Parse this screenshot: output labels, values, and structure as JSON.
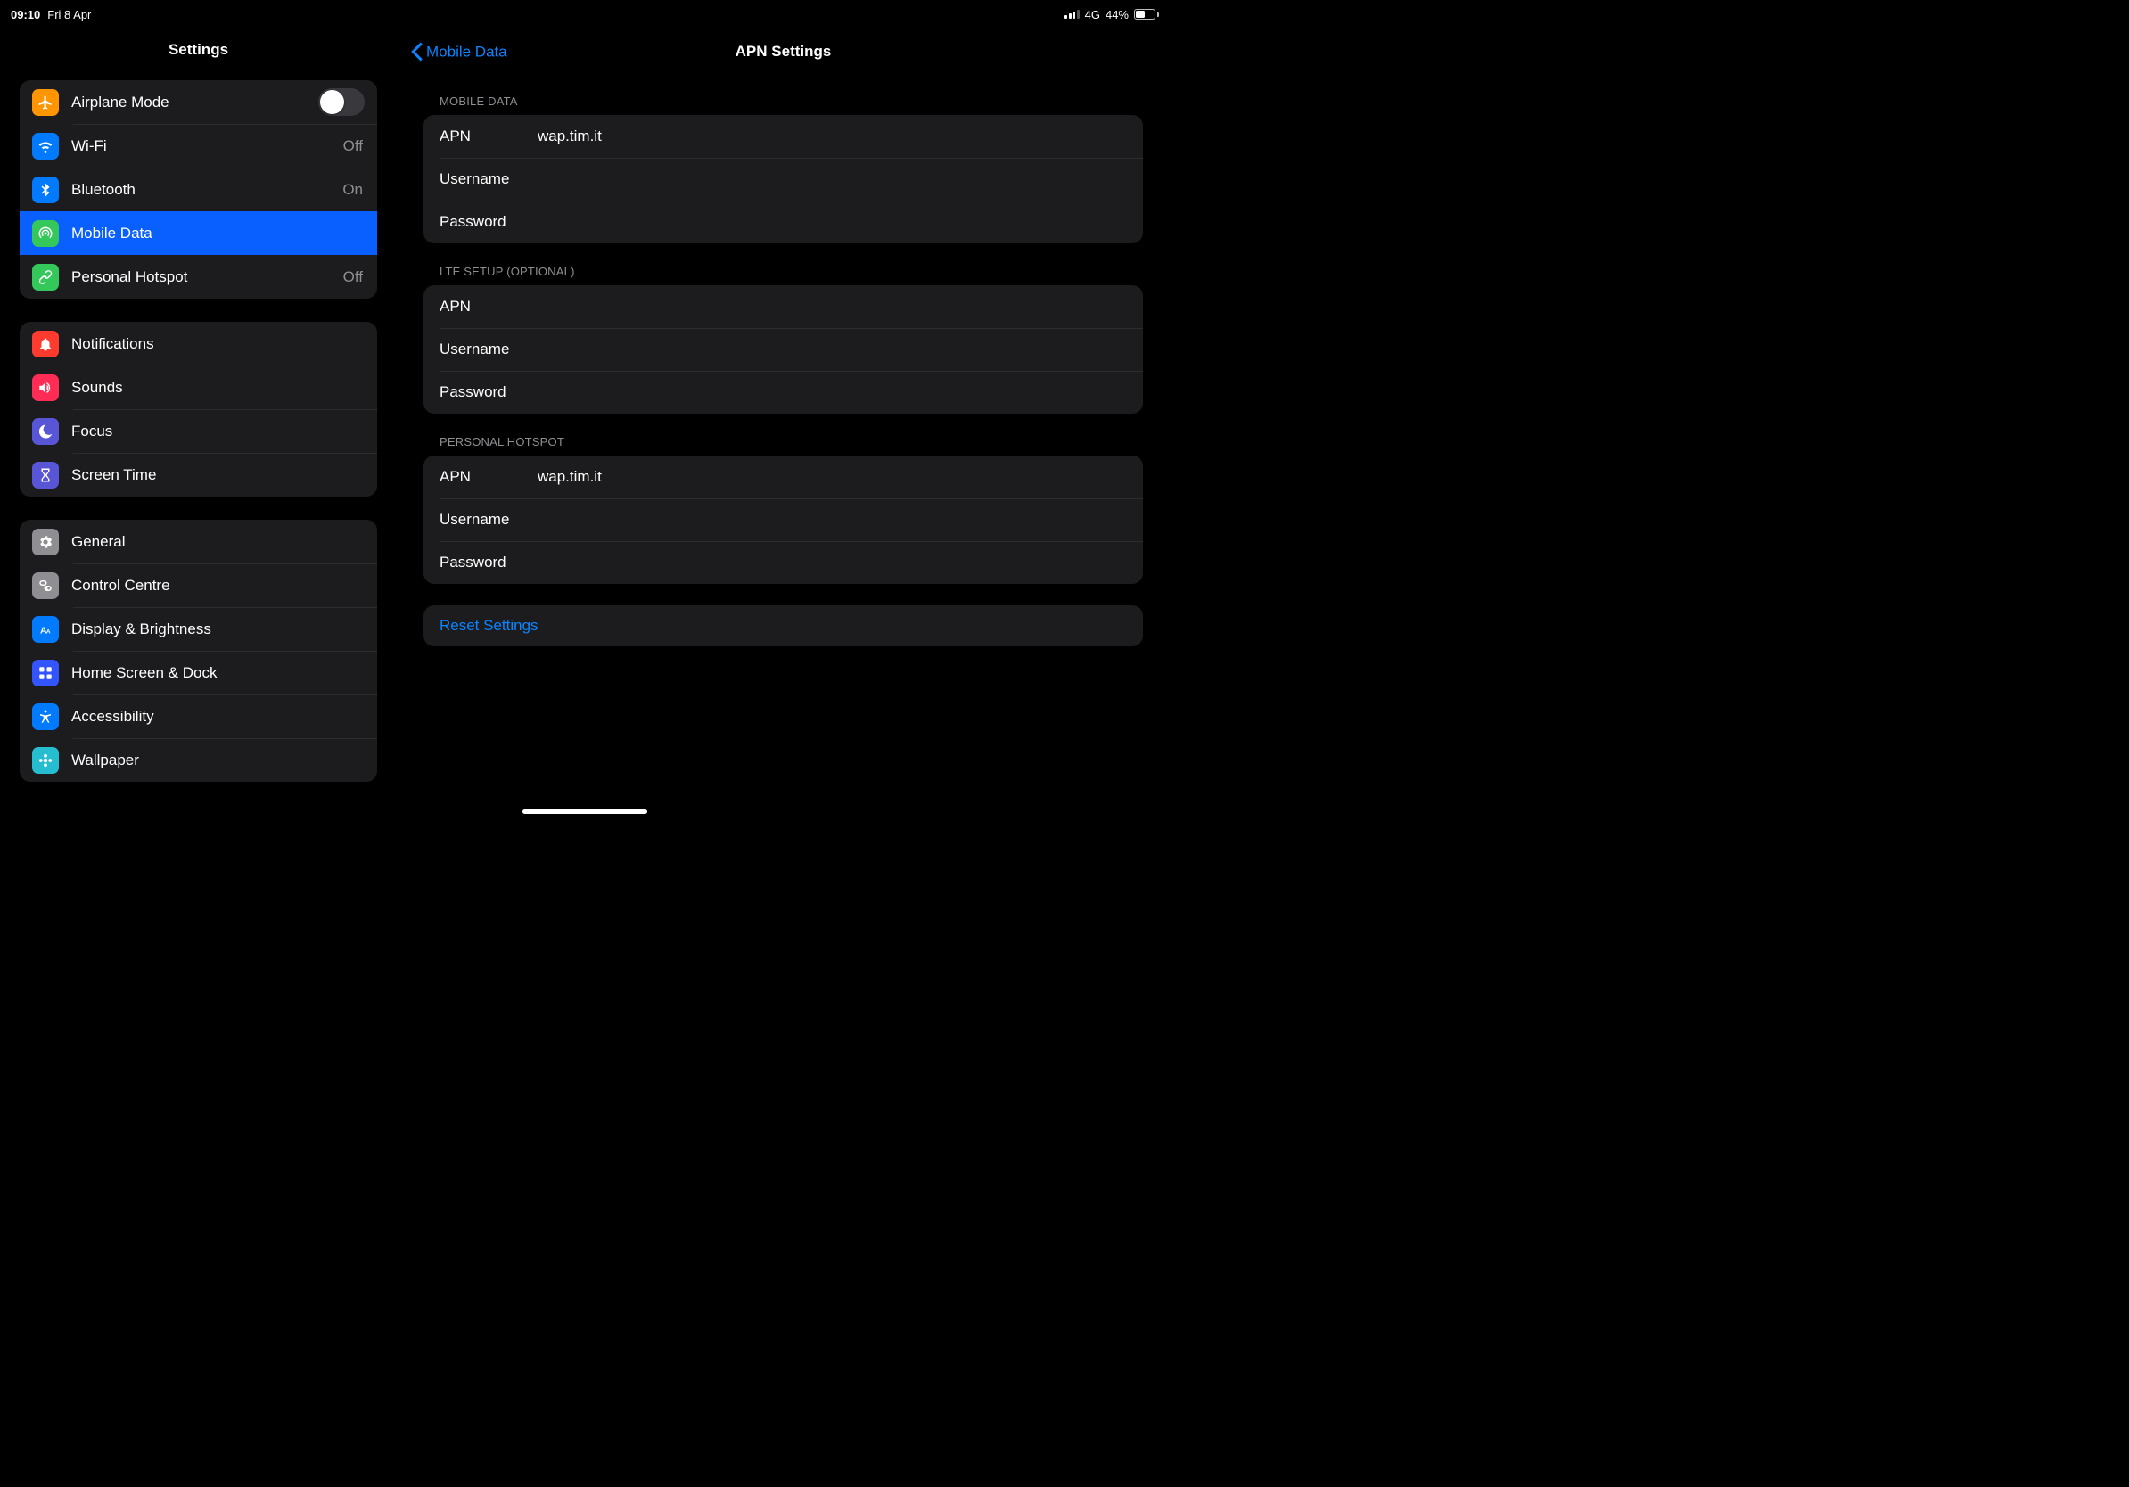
{
  "status": {
    "time": "09:10",
    "date": "Fri 8 Apr",
    "network": "4G",
    "battery_pct": "44%"
  },
  "sidebar": {
    "title": "Settings",
    "groups": [
      [
        {
          "id": "airplane",
          "label": "Airplane Mode",
          "iconBg": "#ff9500",
          "toggle": false
        },
        {
          "id": "wifi",
          "label": "Wi-Fi",
          "value": "Off",
          "iconBg": "#007aff"
        },
        {
          "id": "bluetooth",
          "label": "Bluetooth",
          "value": "On",
          "iconBg": "#007aff"
        },
        {
          "id": "mobiledata",
          "label": "Mobile Data",
          "iconBg": "#34c759",
          "selected": true
        },
        {
          "id": "hotspot",
          "label": "Personal Hotspot",
          "value": "Off",
          "iconBg": "#34c759"
        }
      ],
      [
        {
          "id": "notifications",
          "label": "Notifications",
          "iconBg": "#ff3b30"
        },
        {
          "id": "sounds",
          "label": "Sounds",
          "iconBg": "#ff2d55"
        },
        {
          "id": "focus",
          "label": "Focus",
          "iconBg": "#5856d6"
        },
        {
          "id": "screentime",
          "label": "Screen Time",
          "iconBg": "#5856d6"
        }
      ],
      [
        {
          "id": "general",
          "label": "General",
          "iconBg": "#8e8e93"
        },
        {
          "id": "controlcentre",
          "label": "Control Centre",
          "iconBg": "#8e8e93"
        },
        {
          "id": "display",
          "label": "Display & Brightness",
          "iconBg": "#007aff"
        },
        {
          "id": "homescreen",
          "label": "Home Screen & Dock",
          "iconBg": "#3355ff"
        },
        {
          "id": "accessibility",
          "label": "Accessibility",
          "iconBg": "#007aff"
        },
        {
          "id": "wallpaper",
          "label": "Wallpaper",
          "iconBg": "#27bdd1"
        }
      ]
    ]
  },
  "detail": {
    "back_label": "Mobile Data",
    "title": "APN Settings",
    "sections": [
      {
        "header": "MOBILE DATA",
        "fields": [
          {
            "label": "APN",
            "value": "wap.tim.it"
          },
          {
            "label": "Username",
            "value": ""
          },
          {
            "label": "Password",
            "value": ""
          }
        ]
      },
      {
        "header": "LTE SETUP (OPTIONAL)",
        "fields": [
          {
            "label": "APN",
            "value": ""
          },
          {
            "label": "Username",
            "value": ""
          },
          {
            "label": "Password",
            "value": ""
          }
        ]
      },
      {
        "header": "PERSONAL HOTSPOT",
        "fields": [
          {
            "label": "APN",
            "value": "wap.tim.it"
          },
          {
            "label": "Username",
            "value": ""
          },
          {
            "label": "Password",
            "value": ""
          }
        ]
      }
    ],
    "reset_label": "Reset Settings"
  },
  "icons": {
    "airplane": "airplane-icon",
    "wifi": "wifi-icon",
    "bluetooth": "bluetooth-icon",
    "mobiledata": "antenna-icon",
    "hotspot": "link-icon",
    "notifications": "bell-icon",
    "sounds": "speaker-icon",
    "focus": "moon-icon",
    "screentime": "hourglass-icon",
    "general": "gear-icon",
    "controlcentre": "switches-icon",
    "display": "text-size-icon",
    "homescreen": "grid-icon",
    "accessibility": "accessibility-icon",
    "wallpaper": "flower-icon"
  }
}
